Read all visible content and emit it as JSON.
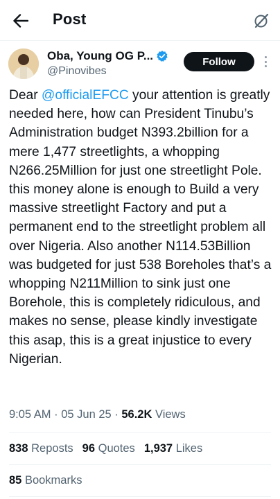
{
  "header": {
    "title": "Post"
  },
  "post": {
    "author": {
      "display_name": "Oba, Young OG P...",
      "handle": "@Pinovibes",
      "verified": true
    },
    "follow_label": "Follow",
    "text_mention": "@officialEFCC",
    "text_before": "Dear ",
    "text_after": " your attention is greatly needed here, how can President Tinubu’s Administration budget N393.2billion for a mere 1,477 streetlights, a whopping N266.25Million for just one streetlight Pole. this money alone is enough to Build a very massive streetlight Factory and put a permanent end to the streetlight problem all over Nigeria. Also another N114.53Billion was budgeted for just 538 Boreholes that’s a whopping N211Million to sink just one Borehole, this is completely ridiculous, and makes no sense, please kindly investigate this asap, this is a great injustice to every Nigerian.",
    "time": "9:05 AM",
    "date": "05 Jun 25",
    "views_count": "56.2K",
    "views_label": "Views",
    "separator": " · "
  },
  "stats": {
    "reposts_count": "838",
    "reposts_label": "Reposts",
    "quotes_count": "96",
    "quotes_label": "Quotes",
    "likes_count": "1,937",
    "likes_label": "Likes",
    "bookmarks_count": "85",
    "bookmarks_label": "Bookmarks"
  },
  "colors": {
    "text": "#0f1419",
    "secondary": "#536471",
    "link": "#1d9bf0",
    "verified": "#1d9bf0",
    "follow_bg": "#0f1419"
  },
  "icons": {
    "back": "arrow-left-icon",
    "grok": "grok-icon",
    "verified": "verified-badge-icon",
    "more": "more-vertical-icon"
  }
}
